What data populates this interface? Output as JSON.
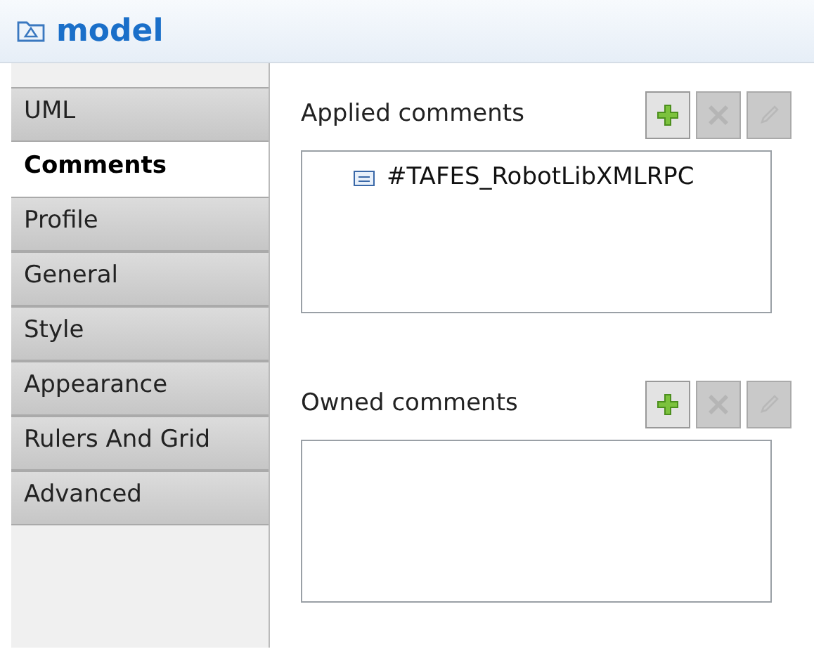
{
  "title": "model",
  "tabs": [
    {
      "label": "UML",
      "selected": false
    },
    {
      "label": "Comments",
      "selected": true
    },
    {
      "label": "Profile",
      "selected": false
    },
    {
      "label": "General",
      "selected": false
    },
    {
      "label": "Style",
      "selected": false
    },
    {
      "label": "Appearance",
      "selected": false
    },
    {
      "label": "Rulers And Grid",
      "selected": false
    },
    {
      "label": "Advanced",
      "selected": false
    }
  ],
  "sections": [
    {
      "label": "Applied comments",
      "buttons": [
        {
          "kind": "add",
          "disabled": false
        },
        {
          "kind": "remove",
          "disabled": true
        },
        {
          "kind": "edit",
          "disabled": true
        }
      ],
      "items": [
        "#TAFES_RobotLibXMLRPC"
      ]
    },
    {
      "label": "Owned comments",
      "buttons": [
        {
          "kind": "add",
          "disabled": false
        },
        {
          "kind": "remove",
          "disabled": true
        },
        {
          "kind": "edit",
          "disabled": true
        }
      ]
    }
  ]
}
